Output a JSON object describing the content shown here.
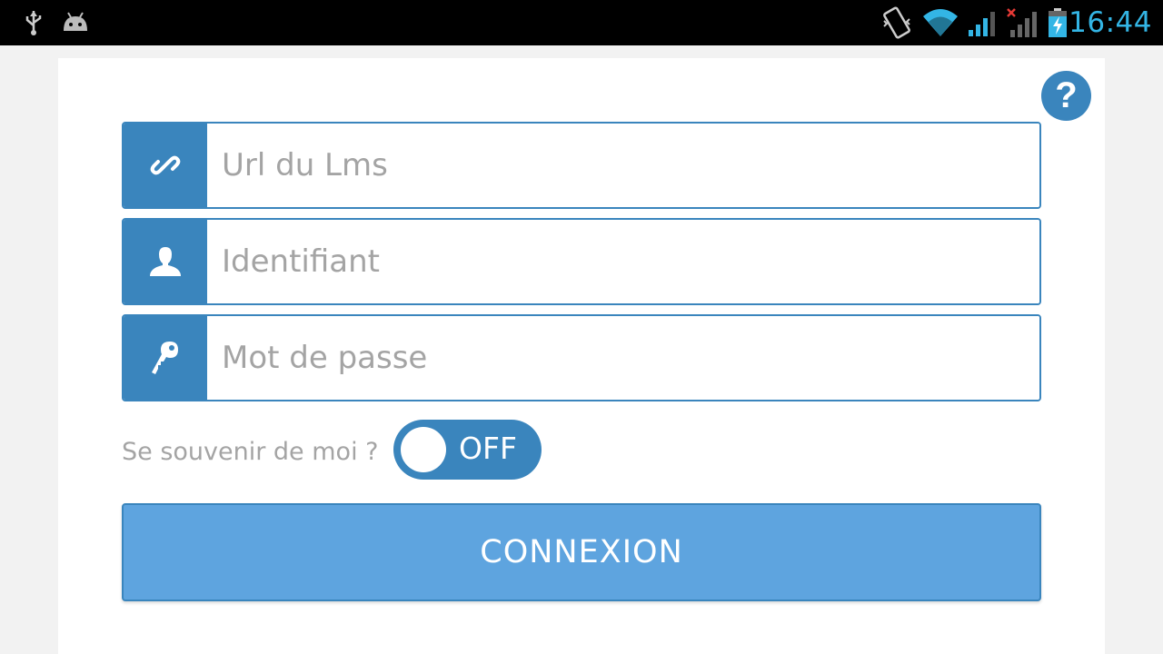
{
  "status_bar": {
    "time": "16:44",
    "icons": [
      "usb-icon",
      "android-debug-icon",
      "vibrate-icon",
      "wifi-icon",
      "signal-icon",
      "signal-no-data-icon",
      "battery-charging-icon"
    ],
    "time_color": "#33b5e5"
  },
  "help_button": {
    "label": "?",
    "icon": "help-icon"
  },
  "fields": {
    "url": {
      "placeholder": "Url du Lms",
      "value": "",
      "icon": "link-icon"
    },
    "username": {
      "placeholder": "Identifiant",
      "value": "",
      "icon": "user-icon"
    },
    "password": {
      "placeholder": "Mot de passe",
      "value": "",
      "icon": "key-icon"
    }
  },
  "remember": {
    "label": "Se souvenir de moi ?",
    "toggle_text": "OFF",
    "state": false
  },
  "login_button": {
    "label": "CONNEXION"
  },
  "colors": {
    "accent": "#3a85bd",
    "button": "#5ea4df",
    "placeholder": "#a4a4a4"
  }
}
